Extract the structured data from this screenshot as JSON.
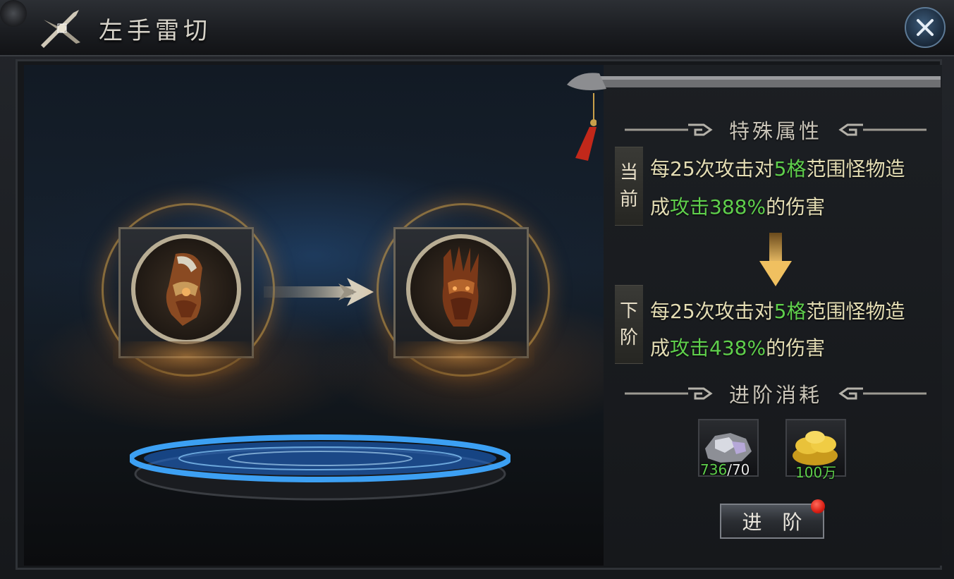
{
  "window": {
    "title": "左手雷切",
    "close_icon": "close-icon"
  },
  "upgrade_preview": {
    "current_item_icon": "gauntlet-armor-icon",
    "next_item_icon": "demon-claw-gauntlet-icon",
    "connector_icon": "arrow-right-icon"
  },
  "special_attributes": {
    "heading": "特殊属性",
    "current": {
      "tag_top": "当",
      "tag_bottom": "前",
      "line1_a": "每25次攻击对",
      "line1_b": "5格",
      "line1_c": "范围怪物造",
      "line2_a": "成",
      "line2_b": "攻击388%",
      "line2_c": "的伤害"
    },
    "next": {
      "tag_top": "下",
      "tag_bottom": "阶",
      "line1_a": "每25次攻击对",
      "line1_b": "5格",
      "line1_c": "范围怪物造",
      "line2_a": "成",
      "line2_b": "攻击438%",
      "line2_c": "的伤害"
    }
  },
  "advance_cost": {
    "heading": "进阶消耗",
    "items": [
      {
        "icon": "silver-ore-icon",
        "owned": "736",
        "separator": "/",
        "required": "70"
      },
      {
        "icon": "gold-coins-icon",
        "amount": "100万"
      }
    ]
  },
  "actions": {
    "advance_label": "进 阶"
  },
  "colors": {
    "highlight_green": "#5fcf4c",
    "text_cream": "#e4ddb4",
    "notify_red": "#d81e14"
  }
}
